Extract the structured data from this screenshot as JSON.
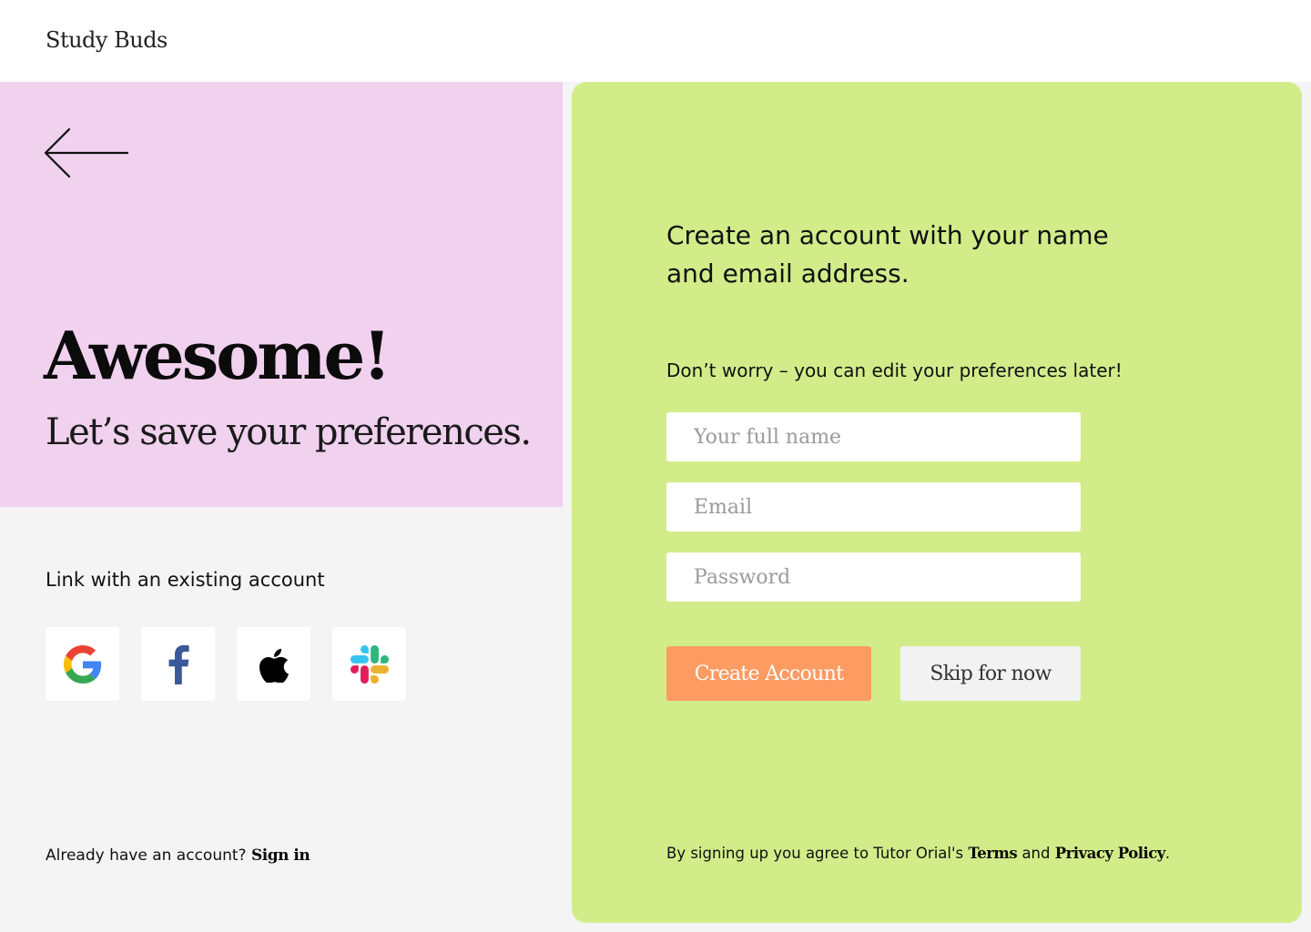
{
  "brand": {
    "name": "Study Buds"
  },
  "hero": {
    "back_icon": "arrow-left-icon",
    "title": "Awesome!",
    "subtitle": "Let’s save your preferences."
  },
  "link_accounts": {
    "heading": "Link with an existing account",
    "providers": [
      {
        "name": "Google",
        "icon": "google-icon"
      },
      {
        "name": "Facebook",
        "icon": "facebook-icon",
        "color": "#3b5998"
      },
      {
        "name": "Apple",
        "icon": "apple-icon",
        "color": "#000000"
      },
      {
        "name": "Slack",
        "icon": "slack-icon"
      }
    ]
  },
  "signin": {
    "prompt": "Already have an account?",
    "link_label": "Sign in"
  },
  "form": {
    "heading": "Create an account with your name and email address.",
    "note": "Don’t worry – you can edit your preferences later!",
    "fields": {
      "name": {
        "placeholder": "Your full name",
        "value": ""
      },
      "email": {
        "placeholder": "Email",
        "value": ""
      },
      "password": {
        "placeholder": "Password",
        "value": ""
      }
    },
    "create_label": "Create Account",
    "skip_label": "Skip for now"
  },
  "terms": {
    "prefix": "By signing up you agree to Tutor Orial's",
    "terms_label": "Terms",
    "conjunction": "and",
    "privacy_label": "Privacy Policy",
    "suffix": "."
  },
  "colors": {
    "header_bg": "#ffffff",
    "hero_bg": "#f0d1ee",
    "page_bg": "#f4f4f4",
    "panel_bg": "#d2ec8a",
    "create_button": "#fd9b62",
    "skip_button": "#f2f2f2"
  }
}
